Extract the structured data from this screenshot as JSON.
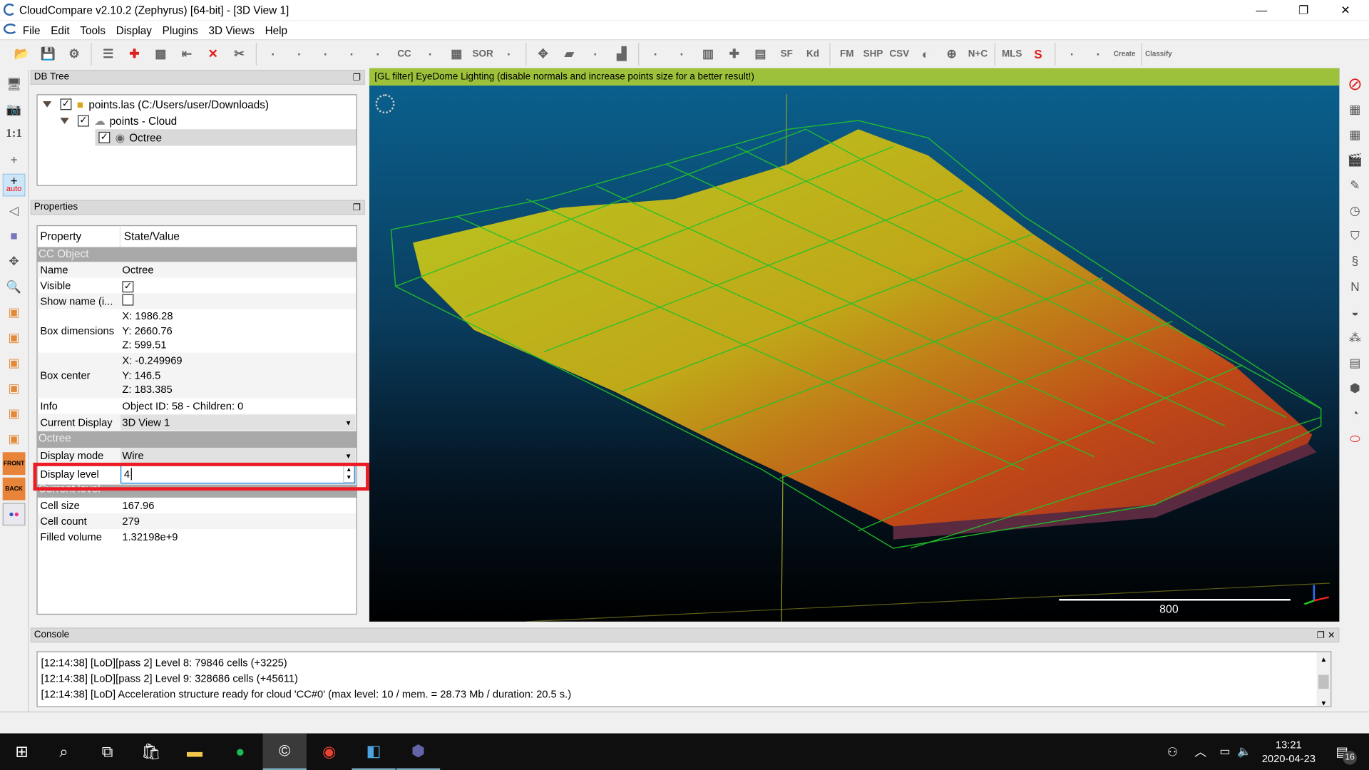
{
  "window": {
    "title": "CloudCompare v2.10.2 (Zephyrus) [64-bit] - [3D View 1]",
    "minimize": "—",
    "restore": "❐",
    "close": "✕"
  },
  "menu": [
    "File",
    "Edit",
    "Tools",
    "Display",
    "Plugins",
    "3D Views",
    "Help"
  ],
  "toolbar_icons": [
    "open-icon",
    "save-icon",
    "settings-icon",
    "list-icon",
    "pick-point-icon",
    "color-icon",
    "export-icon",
    "delete-icon",
    "segment-icon",
    "sample-icon",
    "subsample-icon",
    "mesh-icon",
    "noise-icon",
    "normals-icon",
    "cc-icon",
    "smooth-icon",
    "checker-icon",
    "sor-icon",
    "cut-icon",
    "transform-icon",
    "box-icon",
    "align-icon",
    "histogram-icon",
    "stats-icon",
    "minmax-icon",
    "trash-icon",
    "plus-icon",
    "calc-icon",
    "sf-icon",
    "kd-icon",
    "fm-icon",
    "shp-icon",
    "csv-icon",
    "sphere-icon",
    "globe-icon",
    "nc-icon",
    "mls-icon",
    "profile-icon",
    "section-icon",
    "unroll-icon",
    "canupo-create-icon",
    "canupo-classify-icon"
  ],
  "toolbar_labels": {
    "sor": "SOR",
    "sf": "SF",
    "kd": "Kd",
    "fm": "FM",
    "shp": "SHP",
    "csv": "CSV",
    "nc": "N+C",
    "mls": "MLS",
    "cc": "CC",
    "canupo_create": "Create",
    "canupo_classify": "Classify"
  },
  "left_tools": {
    "one_to_one": "1:1",
    "auto": "auto",
    "front": "FRONT",
    "back": "BACK"
  },
  "db_tree": {
    "title": "DB Tree",
    "items": [
      {
        "label": "points.las (C:/Users/user/Downloads)",
        "checked": true
      },
      {
        "label": "points - Cloud",
        "checked": true
      },
      {
        "label": "Octree",
        "checked": true,
        "selected": true
      }
    ]
  },
  "properties": {
    "title": "Properties",
    "header": [
      "Property",
      "State/Value"
    ],
    "cc_object": "CC Object",
    "name_k": "Name",
    "name_v": "Octree",
    "visible_k": "Visible",
    "visible": true,
    "showname_k": "Show name (i...",
    "showname": false,
    "boxdim_k": "Box dimensions",
    "boxdim": [
      "X: 1986.28",
      "Y: 2660.76",
      "Z: 599.51"
    ],
    "boxcenter_k": "Box center",
    "boxcenter": [
      "X: -0.249969",
      "Y: 146.5",
      "Z: 183.385"
    ],
    "info_k": "Info",
    "info_v": "Object ID: 58 - Children: 0",
    "curdisp_k": "Current Display",
    "curdisp_v": "3D View 1",
    "octree": "Octree",
    "dispmode_k": "Display mode",
    "dispmode_v": "Wire",
    "displevel_k": "Display level",
    "displevel_v": "4",
    "curlevel": "Current level",
    "cellsize_k": "Cell size",
    "cellsize_v": "167.96",
    "cellcount_k": "Cell count",
    "cellcount_v": "279",
    "filled_k": "Filled volume",
    "filled_v": "1.32198e+9"
  },
  "viewport": {
    "banner": "[GL filter] EyeDome Lighting (disable normals and increase points size for a better result!)",
    "scale_label": "800"
  },
  "console": {
    "title": "Console",
    "lines": [
      "[12:14:38] [LoD][pass 2] Level 8: 79846 cells (+3225)",
      "[12:14:38] [LoD][pass 2] Level 9: 328686 cells (+45611)",
      "[12:14:38] [LoD] Acceleration structure ready for cloud 'CC#0' (max level: 10 / mem. = 28.73 Mb / duration: 20.5 s.)"
    ]
  },
  "taskbar": {
    "time": "13:21",
    "date": "2020-04-23",
    "notifications": "16"
  },
  "colors": {
    "highlight": "#ed1c24",
    "banner": "#9dc13b",
    "wire": "#22c22a"
  }
}
